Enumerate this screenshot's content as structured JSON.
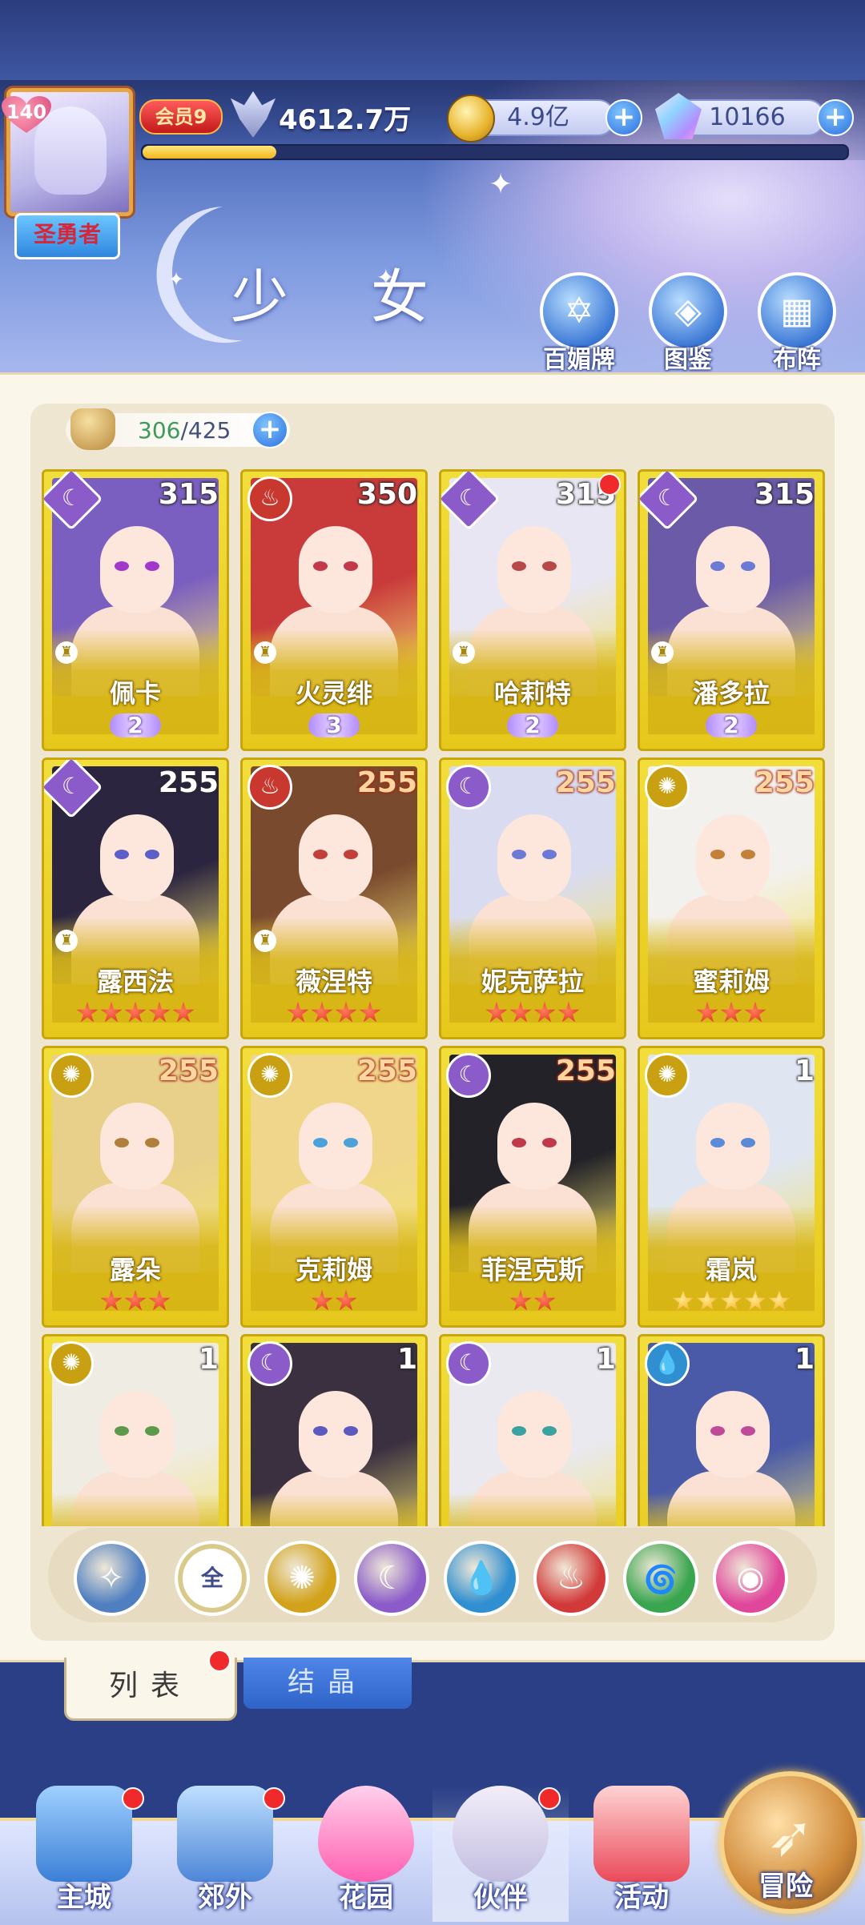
{
  "player": {
    "level": "140",
    "title": "圣勇者",
    "vip": "会员9",
    "power": "4612.7万",
    "exp_progress": 0.19
  },
  "currency": {
    "gold": "4.9亿",
    "gems": "10166"
  },
  "page": {
    "title": "少 女",
    "buttons": [
      {
        "label": "百媚牌",
        "icon": "card-deck-icon"
      },
      {
        "label": "图鉴",
        "icon": "book-icon"
      },
      {
        "label": "布阵",
        "icon": "grid-formation-icon"
      }
    ]
  },
  "inventory": {
    "current": "306",
    "separator": "/",
    "max": "425"
  },
  "cards": [
    {
      "name": "佩卡",
      "level": "315",
      "element": "moon",
      "rank": "2",
      "stars": 0,
      "star_color": "red",
      "notice": false
    },
    {
      "name": "火灵绯",
      "level": "350",
      "element": "fire",
      "rank": "3",
      "stars": 0,
      "star_color": "red",
      "notice": false
    },
    {
      "name": "哈莉特",
      "level": "315",
      "element": "moon",
      "rank": "2",
      "stars": 0,
      "star_color": "red",
      "notice": true
    },
    {
      "name": "潘多拉",
      "level": "315",
      "element": "moon",
      "rank": "2",
      "stars": 0,
      "star_color": "red",
      "notice": false
    },
    {
      "name": "露西法",
      "level": "255",
      "element": "moon",
      "rank": "",
      "stars": 5,
      "star_color": "red",
      "notice": false
    },
    {
      "name": "薇涅特",
      "level": "255",
      "element": "fire",
      "rank": "",
      "stars": 4,
      "star_color": "red",
      "notice": false
    },
    {
      "name": "妮克萨拉",
      "level": "255",
      "element": "moon",
      "rank": "",
      "stars": 4,
      "star_color": "red",
      "notice": false
    },
    {
      "name": "蜜莉姆",
      "level": "255",
      "element": "sun",
      "rank": "",
      "stars": 3,
      "star_color": "red",
      "notice": false
    },
    {
      "name": "露朵",
      "level": "255",
      "element": "sun",
      "rank": "",
      "stars": 3,
      "star_color": "red",
      "notice": false
    },
    {
      "name": "克莉姆",
      "level": "255",
      "element": "sun",
      "rank": "",
      "stars": 2,
      "star_color": "red",
      "notice": false
    },
    {
      "name": "菲涅克斯",
      "level": "255",
      "element": "moon",
      "rank": "",
      "stars": 2,
      "star_color": "red",
      "notice": false
    },
    {
      "name": "霜岚",
      "level": "1",
      "element": "sun",
      "rank": "",
      "stars": 5,
      "star_color": "gold",
      "notice": false
    },
    {
      "name": "",
      "level": "1",
      "element": "sun",
      "rank": "",
      "stars": 0,
      "star_color": "red",
      "notice": false
    },
    {
      "name": "",
      "level": "1",
      "element": "moon",
      "rank": "",
      "stars": 0,
      "star_color": "red",
      "notice": false
    },
    {
      "name": "",
      "level": "1",
      "element": "moon",
      "rank": "",
      "stars": 0,
      "star_color": "red",
      "notice": false
    },
    {
      "name": "",
      "level": "1",
      "element": "water",
      "rank": "",
      "stars": 0,
      "star_color": "red",
      "notice": false
    }
  ],
  "filters": [
    {
      "id": "star",
      "label": "",
      "icon": "star-burst-icon",
      "color": "#4f7fc0"
    },
    {
      "id": "all",
      "label": "全",
      "icon": "",
      "color": "#ffffff"
    },
    {
      "id": "sun",
      "label": "",
      "icon": "sun-icon",
      "color": "#d2a21a"
    },
    {
      "id": "moon",
      "label": "",
      "icon": "moon-icon",
      "color": "#8b5cc9"
    },
    {
      "id": "water",
      "label": "",
      "icon": "water-icon",
      "color": "#2f8fd0"
    },
    {
      "id": "fire",
      "label": "",
      "icon": "fire-icon",
      "color": "#d23a3a"
    },
    {
      "id": "wind",
      "label": "",
      "icon": "wind-icon",
      "color": "#3aa54f"
    },
    {
      "id": "void",
      "label": "",
      "icon": "orb-icon",
      "color": "#e0479b"
    }
  ],
  "tabs": {
    "list": "列表",
    "crystal": "结晶"
  },
  "nav": [
    {
      "label": "主城",
      "icon": "castle-icon",
      "notice": true
    },
    {
      "label": "郊外",
      "icon": "gate-icon",
      "notice": true
    },
    {
      "label": "花园",
      "icon": "heart-icon",
      "notice": false
    },
    {
      "label": "伙伴",
      "icon": "partner-icon",
      "notice": true
    },
    {
      "label": "活动",
      "icon": "gift-icon",
      "notice": false
    },
    {
      "label": "冒险",
      "icon": "compass-icon",
      "notice": false
    }
  ],
  "element_colors": {
    "moon": "#8b5cc9",
    "fire": "#c8382e",
    "sun": "#c9a012",
    "water": "#2f8fd0"
  }
}
